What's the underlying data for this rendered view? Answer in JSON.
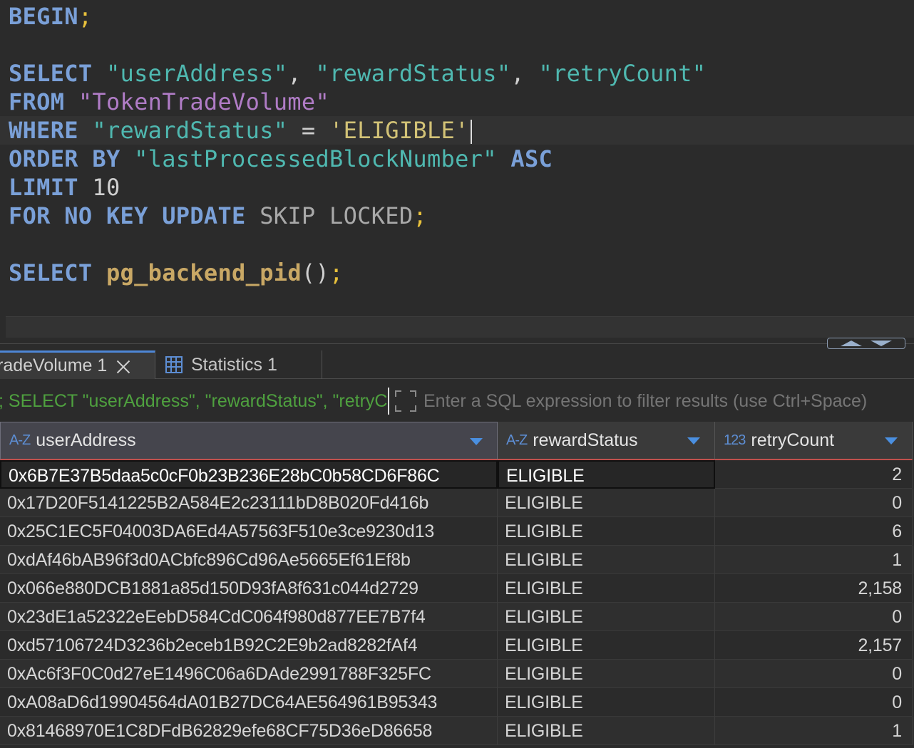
{
  "editor": {
    "lines": [
      {
        "tokens": [
          {
            "t": "BEGIN",
            "c": "kw"
          },
          {
            "t": ";",
            "c": "semi"
          }
        ]
      },
      {
        "tokens": []
      },
      {
        "tokens": [
          {
            "t": "SELECT ",
            "c": "kw"
          },
          {
            "t": "\"userAddress\"",
            "c": "str-ident"
          },
          {
            "t": ", ",
            "c": "punc"
          },
          {
            "t": "\"rewardStatus\"",
            "c": "str-ident"
          },
          {
            "t": ", ",
            "c": "punc"
          },
          {
            "t": "\"retryCount\"",
            "c": "str-ident"
          }
        ]
      },
      {
        "tokens": [
          {
            "t": "FROM ",
            "c": "kw"
          },
          {
            "t": "\"TokenTradeVolume\"",
            "c": "str-table"
          }
        ]
      },
      {
        "tokens": [
          {
            "t": "WHERE ",
            "c": "kw"
          },
          {
            "t": "\"rewardStatus\"",
            "c": "str-ident"
          },
          {
            "t": " = ",
            "c": "punc"
          },
          {
            "t": "'ELIGIBLE'",
            "c": "str-lit"
          }
        ],
        "caret": true
      },
      {
        "tokens": [
          {
            "t": "ORDER BY ",
            "c": "kw"
          },
          {
            "t": "\"lastProcessedBlockNumber\"",
            "c": "str-ident"
          },
          {
            "t": " ",
            "c": "punc"
          },
          {
            "t": "ASC",
            "c": "kw"
          }
        ]
      },
      {
        "tokens": [
          {
            "t": "LIMIT ",
            "c": "kw"
          },
          {
            "t": "10",
            "c": "num"
          }
        ]
      },
      {
        "tokens": [
          {
            "t": "FOR NO KEY UPDATE ",
            "c": "kw"
          },
          {
            "t": "SKIP LOCKED",
            "c": "dim"
          },
          {
            "t": ";",
            "c": "semi"
          }
        ]
      },
      {
        "tokens": []
      },
      {
        "tokens": [
          {
            "t": "SELECT ",
            "c": "kw"
          },
          {
            "t": "pg_backend_pid",
            "c": "fn"
          },
          {
            "t": "()",
            "c": "punc"
          },
          {
            "t": ";",
            "c": "semi"
          }
        ]
      }
    ]
  },
  "tabs": {
    "results_label": "radeVolume 1",
    "statistics_label": "Statistics 1"
  },
  "filter": {
    "query_preview": "; SELECT \"userAddress\", \"rewardStatus\", \"retryCount\"",
    "placeholder": "Enter a SQL expression to filter results (use Ctrl+Space)"
  },
  "grid": {
    "columns": [
      {
        "type_badge": "A-Z",
        "name": "userAddress"
      },
      {
        "type_badge": "A-Z",
        "name": "rewardStatus"
      },
      {
        "type_badge": "123",
        "name": "retryCount"
      }
    ],
    "rows": [
      [
        "0x6B7E37B5daa5c0cF0b23B236E28bC0b58CD6F86C",
        "ELIGIBLE",
        "2"
      ],
      [
        "0x17D20F5141225B2A584E2c23111bD8B020Fd416b",
        "ELIGIBLE",
        "0"
      ],
      [
        "0x25C1EC5F04003DA6Ed4A57563F510e3ce9230d13",
        "ELIGIBLE",
        "6"
      ],
      [
        "0xdAf46bAB96f3d0ACbfc896Cd96Ae5665Ef61Ef8b",
        "ELIGIBLE",
        "1"
      ],
      [
        "0x066e880DCB1881a85d150D93fA8f631c044d2729",
        "ELIGIBLE",
        "2,158"
      ],
      [
        "0x23dE1a52322eEebD584CdC064f980d877EE7B7f4",
        "ELIGIBLE",
        "0"
      ],
      [
        "0xd57106724D3236b2eceb1B92C2E9b2ad8282fAf4",
        "ELIGIBLE",
        "2,157"
      ],
      [
        "0xAc6f3F0C0d27eE1496C06a6DAde2991788F325FC",
        "ELIGIBLE",
        "0"
      ],
      [
        "0xA08aD6d19904564dA01B27DC64AE564961B95343",
        "ELIGIBLE",
        "0"
      ],
      [
        "0x81468970E1C8DFdB62829efe68CF75D36eD86658",
        "ELIGIBLE",
        "1"
      ]
    ]
  }
}
